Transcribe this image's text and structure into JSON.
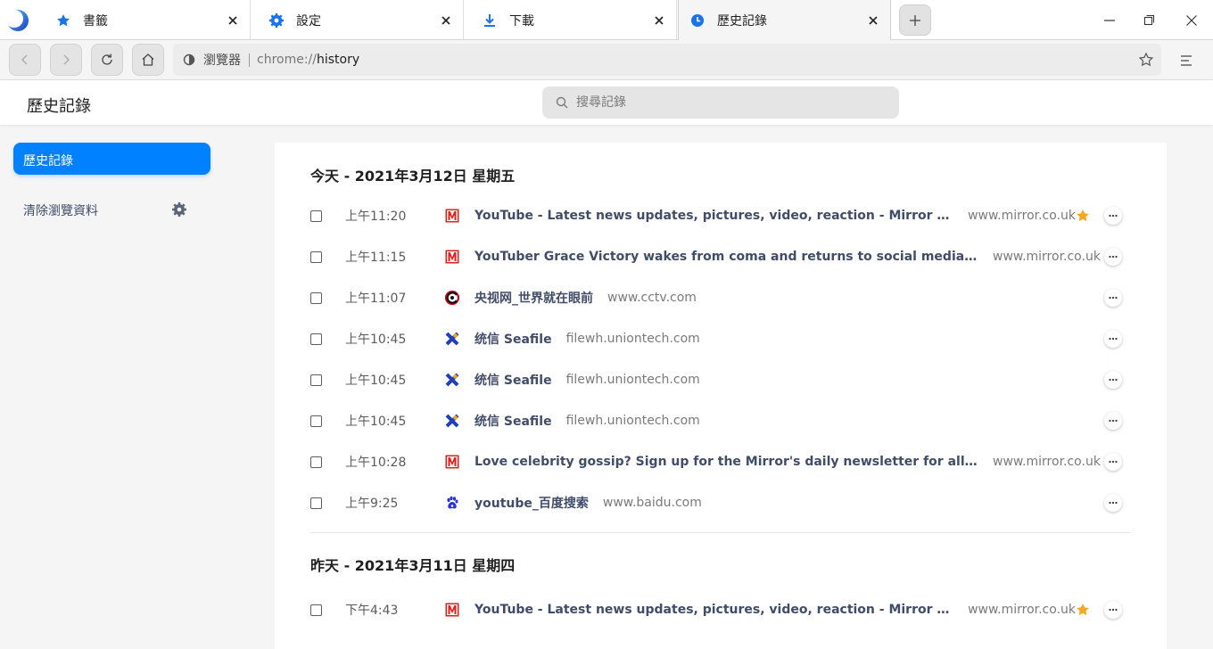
{
  "tabs": [
    {
      "title": "書籤",
      "icon": "bookmark-star-icon"
    },
    {
      "title": "設定",
      "icon": "settings-gear-icon"
    },
    {
      "title": "下載",
      "icon": "download-icon"
    },
    {
      "title": "歷史記錄",
      "icon": "history-clock-icon",
      "active": true
    }
  ],
  "toolbar": {
    "site_label": "瀏覽器",
    "url_scheme": "chrome://",
    "url_path": "history"
  },
  "header": {
    "title": "歷史記錄",
    "search_placeholder": "搜尋記錄"
  },
  "sidebar": {
    "active_item": "歷史記錄",
    "clear_label": "清除瀏覽資料"
  },
  "groups": [
    {
      "heading": "今天 - 2021年3月12日 星期五",
      "entries": [
        {
          "time": "上午11:20",
          "title": "YouTube - Latest news updates, pictures, video, reaction - Mirror Online",
          "domain": "www.mirror.co.uk",
          "favicon": "mirror",
          "starred": true
        },
        {
          "time": "上午11:15",
          "title": "YouTuber Grace Victory wakes from coma and returns to social media after Covid battle - Mirror Online",
          "domain": "www.mirror.co.uk",
          "favicon": "mirror",
          "starred": false,
          "truncated": true
        },
        {
          "time": "上午11:07",
          "title": "央视网_世界就在眼前",
          "domain": "www.cctv.com",
          "favicon": "cctv",
          "starred": false
        },
        {
          "time": "上午10:45",
          "title": "统信 Seafile",
          "domain": "filewh.uniontech.com",
          "favicon": "uniontech",
          "starred": false
        },
        {
          "time": "上午10:45",
          "title": "统信 Seafile",
          "domain": "filewh.uniontech.com",
          "favicon": "uniontech",
          "starred": false
        },
        {
          "time": "上午10:45",
          "title": "统信 Seafile",
          "domain": "filewh.uniontech.com",
          "favicon": "uniontech",
          "starred": false
        },
        {
          "time": "上午10:28",
          "title": "Love celebrity gossip? Sign up for the Mirror's daily newsletter for all the juiciest news - Mirror Online",
          "domain": "www.mirror.co.uk",
          "favicon": "mirror",
          "starred": false,
          "truncated": true
        },
        {
          "time": "上午9:25",
          "title": "youtube_百度搜索",
          "domain": "www.baidu.com",
          "favicon": "baidu",
          "starred": false
        }
      ]
    },
    {
      "heading": "昨天 - 2021年3月11日 星期四",
      "entries": [
        {
          "time": "下午4:43",
          "title": "YouTube - Latest news updates, pictures, video, reaction - Mirror Online",
          "domain": "www.mirror.co.uk",
          "favicon": "mirror",
          "starred": true
        }
      ]
    }
  ],
  "colors": {
    "accent": "#0081ff",
    "star": "#f5a623",
    "mirror_red": "#e0201b",
    "link_text": "#414d68"
  }
}
